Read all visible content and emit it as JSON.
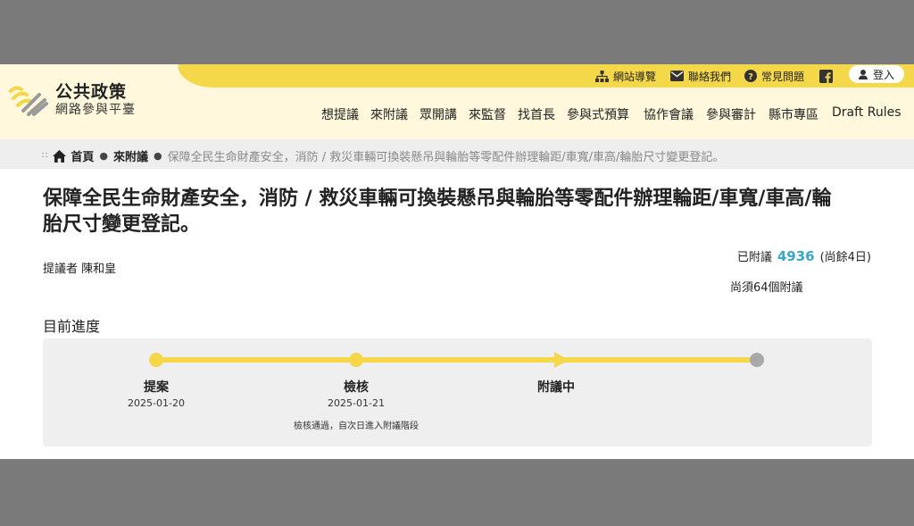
{
  "brand": {
    "title": "公共政策",
    "subtitle": "網路參與平臺",
    "accent": "#f4d84a",
    "header_bg": "#fff8dc"
  },
  "utility": {
    "sitemap": "網站導覽",
    "contact": "聯絡我們",
    "faq": "常見問題",
    "login": "登入",
    "icons": [
      "sitemap-icon",
      "mail-icon",
      "help-icon",
      "facebook-icon",
      "user-icon"
    ]
  },
  "nav": [
    "想提議",
    "來附議",
    "眾開講",
    "來監督",
    "找首長",
    "參與式預算",
    "協作會議",
    "參與審計",
    "縣市專區",
    "Draft Rules"
  ],
  "breadcrumb": {
    "home": "首頁",
    "section": "來附議",
    "current": "保障全民生命財產安全，消防 / 救災車輛可換裝懸吊與輪胎等零配件辦理輪距/車寬/車高/輪胎尺寸變更登記。"
  },
  "proposal": {
    "title": "保障全民生命財產安全，消防 / 救災車輛可換裝懸吊與輪胎等零配件辦理輪距/車寬/車高/輪胎尺寸變更登記。",
    "proposer_label": "提議者",
    "proposer_name": "陳和皇",
    "signed_label": "已附議",
    "signed_count": "4936",
    "days_left": "(尚餘4日)",
    "needed": "尚須64個附議",
    "count_color": "#3aa7c4"
  },
  "progress": {
    "title": "目前進度",
    "stages": [
      {
        "label": "提案",
        "date": "2025-01-20",
        "note": ""
      },
      {
        "label": "檢核",
        "date": "2025-01-21",
        "note": "檢核通過，自次日進入附議階段"
      },
      {
        "label": "附議中",
        "date": "",
        "note": ""
      },
      {
        "label": "",
        "date": "",
        "note": ""
      }
    ]
  }
}
